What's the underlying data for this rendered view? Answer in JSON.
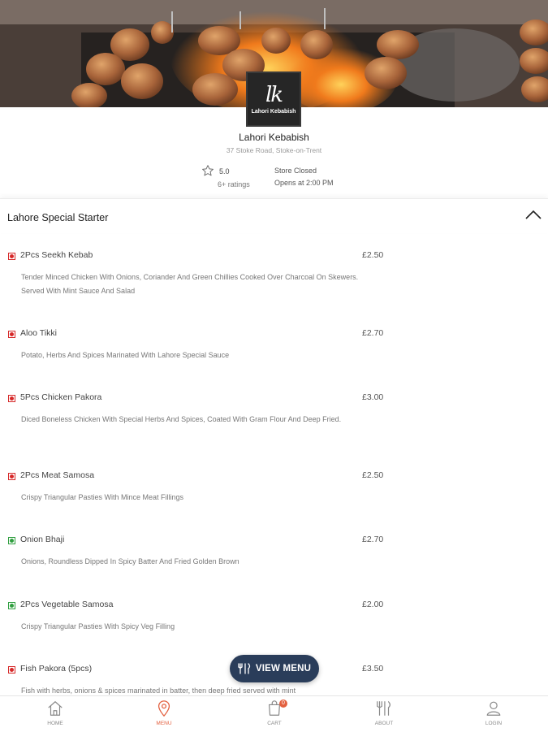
{
  "store": {
    "logo_mark": "lk",
    "logo_text": "Lahori Kebabish",
    "name": "Lahori Kebabish",
    "address": "37 Stoke Road, Stoke-on-Trent",
    "rating": "5.0",
    "rating_count": "6+ ratings",
    "status": "Store Closed",
    "opens": "Opens at 2:00 PM"
  },
  "section": {
    "title": "Lahore Special Starter"
  },
  "menu_items": [
    {
      "name": "2Pcs Seekh Kebab",
      "price": "£2.50",
      "type": "non-veg",
      "description": "Tender Minced Chicken With Onions, Coriander And Green Chillies Cooked Over Charcoal On Skewers. Served With Mint Sauce And Salad"
    },
    {
      "name": "Aloo Tikki",
      "price": "£2.70",
      "type": "non-veg",
      "description": "Potato, Herbs And Spices Marinated With Lahore Special Sauce"
    },
    {
      "name": "5Pcs Chicken Pakora",
      "price": "£3.00",
      "type": "non-veg",
      "description": "Diced Boneless Chicken With Special Herbs And Spices, Coated With Gram Flour And Deep Fried."
    },
    {
      "name": "2Pcs Meat Samosa",
      "price": "£2.50",
      "type": "non-veg",
      "description": "Crispy Triangular Pasties With Mince Meat Fillings"
    },
    {
      "name": "Onion Bhaji",
      "price": "£2.70",
      "type": "veg",
      "description": "Onions, Roundless Dipped In Spicy Batter And Fried Golden Brown"
    },
    {
      "name": "2Pcs Vegetable Samosa",
      "price": "£2.00",
      "type": "veg",
      "description": "Crispy Triangular Pasties With Spicy Veg Filling"
    },
    {
      "name": "Fish Pakora (5pcs)",
      "price": "£3.50",
      "type": "non-veg",
      "description": "Fish with herbs, onions & spices marinated in batter, then deep fried served with mint"
    }
  ],
  "view_menu_button": {
    "label": "VIEW MENU",
    "icon": "utensils-icon"
  },
  "bottom_nav": {
    "items": [
      {
        "label": "HOME",
        "icon": "home-icon"
      },
      {
        "label": "MENU",
        "icon": "location-pin-icon",
        "active": true
      },
      {
        "label": "CART",
        "icon": "shopping-bag-icon",
        "badge": "0"
      },
      {
        "label": "ABOUT",
        "icon": "utensils-icon"
      },
      {
        "label": "LOGIN",
        "icon": "user-icon"
      }
    ]
  },
  "colors": {
    "accent": "#e3603f",
    "button": "#2a3d5a",
    "veg": "#2e9e3e",
    "non_veg": "#d62828"
  }
}
